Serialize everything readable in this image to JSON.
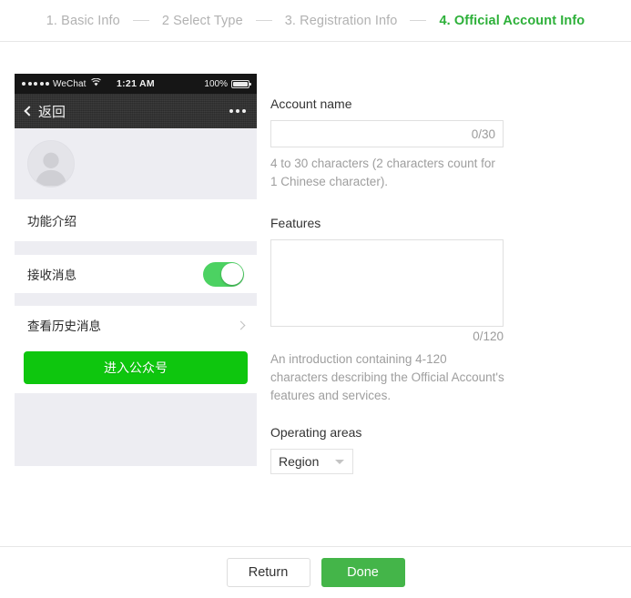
{
  "steps": [
    {
      "label": "1. Basic Info",
      "active": false
    },
    {
      "label": "2 Select Type",
      "active": false
    },
    {
      "label": "3. Registration Info",
      "active": false
    },
    {
      "label": "4. Official Account Info",
      "active": true
    }
  ],
  "phone_preview": {
    "status_bar": {
      "carrier": "WeChat",
      "signal_dots": 5,
      "wifi_icon": "wifi-icon",
      "time": "1:21 AM",
      "battery_percent": "100%",
      "battery_icon": "battery-full-icon"
    },
    "nav_bar": {
      "back_label": "返回",
      "back_icon": "chevron-left-icon",
      "more_icon": "more-dots-icon"
    },
    "avatar_icon": "person-avatar-icon",
    "rows": [
      {
        "label": "功能介绍",
        "type": "title"
      },
      {
        "label": "接收消息",
        "type": "switch",
        "switch_on": true
      },
      {
        "label": "查看历史消息",
        "type": "link",
        "chevron_icon": "chevron-right-icon"
      }
    ],
    "enter_button_label": "进入公众号"
  },
  "form": {
    "account_name": {
      "label": "Account name",
      "value": "",
      "placeholder": "",
      "counter": "0/30",
      "hint": "4 to 30 characters (2 characters count for 1 Chinese character)."
    },
    "features": {
      "label": "Features",
      "value": "",
      "placeholder": "",
      "counter": "0/120",
      "hint": "An introduction containing 4-120 characters describing the Official Account's features and services."
    },
    "operating_areas": {
      "label": "Operating areas",
      "selected": "Region",
      "caret_icon": "chevron-down-icon"
    }
  },
  "footer": {
    "return_label": "Return",
    "done_label": "Done"
  },
  "colors": {
    "accent_green": "#2db039",
    "done_green": "#44b549",
    "wechat_green": "#0ec60e",
    "switch_green": "#4cd262",
    "muted_text": "#9e9e9e",
    "step_inactive": "#b2b2b2"
  }
}
